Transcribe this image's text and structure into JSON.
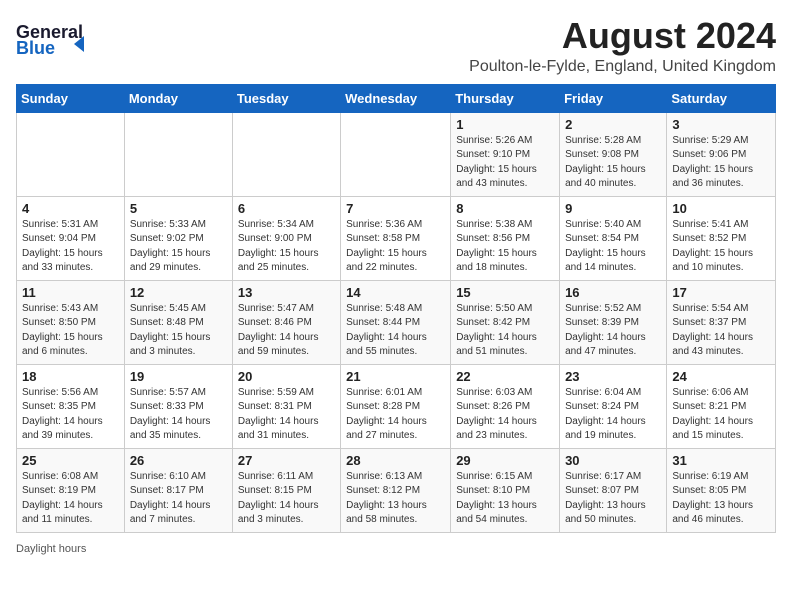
{
  "header": {
    "logo_line1": "General",
    "logo_line2": "Blue",
    "month_year": "August 2024",
    "location": "Poulton-le-Fylde, England, United Kingdom"
  },
  "days_of_week": [
    "Sunday",
    "Monday",
    "Tuesday",
    "Wednesday",
    "Thursday",
    "Friday",
    "Saturday"
  ],
  "weeks": [
    [
      {
        "day": "",
        "info": ""
      },
      {
        "day": "",
        "info": ""
      },
      {
        "day": "",
        "info": ""
      },
      {
        "day": "",
        "info": ""
      },
      {
        "day": "1",
        "info": "Sunrise: 5:26 AM\nSunset: 9:10 PM\nDaylight: 15 hours\nand 43 minutes."
      },
      {
        "day": "2",
        "info": "Sunrise: 5:28 AM\nSunset: 9:08 PM\nDaylight: 15 hours\nand 40 minutes."
      },
      {
        "day": "3",
        "info": "Sunrise: 5:29 AM\nSunset: 9:06 PM\nDaylight: 15 hours\nand 36 minutes."
      }
    ],
    [
      {
        "day": "4",
        "info": "Sunrise: 5:31 AM\nSunset: 9:04 PM\nDaylight: 15 hours\nand 33 minutes."
      },
      {
        "day": "5",
        "info": "Sunrise: 5:33 AM\nSunset: 9:02 PM\nDaylight: 15 hours\nand 29 minutes."
      },
      {
        "day": "6",
        "info": "Sunrise: 5:34 AM\nSunset: 9:00 PM\nDaylight: 15 hours\nand 25 minutes."
      },
      {
        "day": "7",
        "info": "Sunrise: 5:36 AM\nSunset: 8:58 PM\nDaylight: 15 hours\nand 22 minutes."
      },
      {
        "day": "8",
        "info": "Sunrise: 5:38 AM\nSunset: 8:56 PM\nDaylight: 15 hours\nand 18 minutes."
      },
      {
        "day": "9",
        "info": "Sunrise: 5:40 AM\nSunset: 8:54 PM\nDaylight: 15 hours\nand 14 minutes."
      },
      {
        "day": "10",
        "info": "Sunrise: 5:41 AM\nSunset: 8:52 PM\nDaylight: 15 hours\nand 10 minutes."
      }
    ],
    [
      {
        "day": "11",
        "info": "Sunrise: 5:43 AM\nSunset: 8:50 PM\nDaylight: 15 hours\nand 6 minutes."
      },
      {
        "day": "12",
        "info": "Sunrise: 5:45 AM\nSunset: 8:48 PM\nDaylight: 15 hours\nand 3 minutes."
      },
      {
        "day": "13",
        "info": "Sunrise: 5:47 AM\nSunset: 8:46 PM\nDaylight: 14 hours\nand 59 minutes."
      },
      {
        "day": "14",
        "info": "Sunrise: 5:48 AM\nSunset: 8:44 PM\nDaylight: 14 hours\nand 55 minutes."
      },
      {
        "day": "15",
        "info": "Sunrise: 5:50 AM\nSunset: 8:42 PM\nDaylight: 14 hours\nand 51 minutes."
      },
      {
        "day": "16",
        "info": "Sunrise: 5:52 AM\nSunset: 8:39 PM\nDaylight: 14 hours\nand 47 minutes."
      },
      {
        "day": "17",
        "info": "Sunrise: 5:54 AM\nSunset: 8:37 PM\nDaylight: 14 hours\nand 43 minutes."
      }
    ],
    [
      {
        "day": "18",
        "info": "Sunrise: 5:56 AM\nSunset: 8:35 PM\nDaylight: 14 hours\nand 39 minutes."
      },
      {
        "day": "19",
        "info": "Sunrise: 5:57 AM\nSunset: 8:33 PM\nDaylight: 14 hours\nand 35 minutes."
      },
      {
        "day": "20",
        "info": "Sunrise: 5:59 AM\nSunset: 8:31 PM\nDaylight: 14 hours\nand 31 minutes."
      },
      {
        "day": "21",
        "info": "Sunrise: 6:01 AM\nSunset: 8:28 PM\nDaylight: 14 hours\nand 27 minutes."
      },
      {
        "day": "22",
        "info": "Sunrise: 6:03 AM\nSunset: 8:26 PM\nDaylight: 14 hours\nand 23 minutes."
      },
      {
        "day": "23",
        "info": "Sunrise: 6:04 AM\nSunset: 8:24 PM\nDaylight: 14 hours\nand 19 minutes."
      },
      {
        "day": "24",
        "info": "Sunrise: 6:06 AM\nSunset: 8:21 PM\nDaylight: 14 hours\nand 15 minutes."
      }
    ],
    [
      {
        "day": "25",
        "info": "Sunrise: 6:08 AM\nSunset: 8:19 PM\nDaylight: 14 hours\nand 11 minutes."
      },
      {
        "day": "26",
        "info": "Sunrise: 6:10 AM\nSunset: 8:17 PM\nDaylight: 14 hours\nand 7 minutes."
      },
      {
        "day": "27",
        "info": "Sunrise: 6:11 AM\nSunset: 8:15 PM\nDaylight: 14 hours\nand 3 minutes."
      },
      {
        "day": "28",
        "info": "Sunrise: 6:13 AM\nSunset: 8:12 PM\nDaylight: 13 hours\nand 58 minutes."
      },
      {
        "day": "29",
        "info": "Sunrise: 6:15 AM\nSunset: 8:10 PM\nDaylight: 13 hours\nand 54 minutes."
      },
      {
        "day": "30",
        "info": "Sunrise: 6:17 AM\nSunset: 8:07 PM\nDaylight: 13 hours\nand 50 minutes."
      },
      {
        "day": "31",
        "info": "Sunrise: 6:19 AM\nSunset: 8:05 PM\nDaylight: 13 hours\nand 46 minutes."
      }
    ]
  ],
  "footer": {
    "note": "Daylight hours"
  }
}
